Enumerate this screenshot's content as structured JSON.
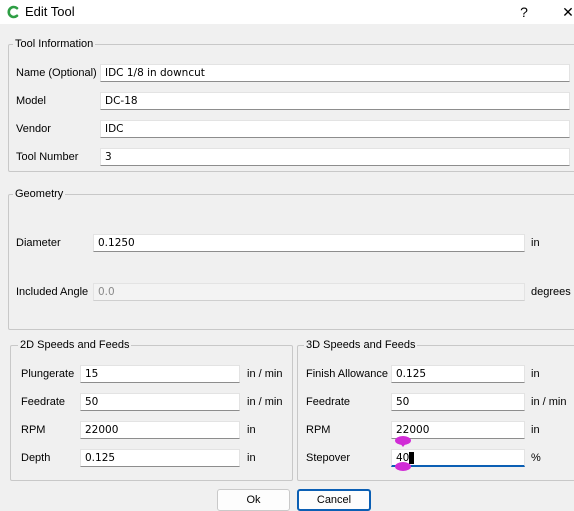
{
  "window": {
    "title": "Edit Tool",
    "help_label": "?",
    "close_label": "✕",
    "icon": "app-logo-icon"
  },
  "tool_info": {
    "legend": "Tool Information",
    "name_label": "Name (Optional)",
    "name_value": "IDC 1/8 in downcut",
    "model_label": "Model",
    "model_value": "DC-18",
    "vendor_label": "Vendor",
    "vendor_value": "IDC",
    "tool_number_label": "Tool Number",
    "tool_number_value": "3"
  },
  "geometry": {
    "legend": "Geometry",
    "diameter_label": "Diameter",
    "diameter_value": "0.1250",
    "diameter_unit": "in",
    "angle_label": "Included Angle",
    "angle_value": "0.0",
    "angle_unit": "degrees"
  },
  "speeds_2d": {
    "legend": "2D Speeds and Feeds",
    "plungerate_label": "Plungerate",
    "plungerate_value": "15",
    "plungerate_unit": "in / min",
    "feedrate_label": "Feedrate",
    "feedrate_value": "50",
    "feedrate_unit": "in / min",
    "rpm_label": "RPM",
    "rpm_value": "22000",
    "rpm_unit": "in",
    "depth_label": "Depth",
    "depth_value": "0.125",
    "depth_unit": "in"
  },
  "speeds_3d": {
    "legend": "3D Speeds and Feeds",
    "finish_label": "Finish Allowance",
    "finish_value": "0.125",
    "finish_unit": "in",
    "feedrate_label": "Feedrate",
    "feedrate_value": "50",
    "feedrate_unit": "in / min",
    "rpm_label": "RPM",
    "rpm_value": "22000",
    "rpm_unit": "in",
    "stepover_label": "Stepover",
    "stepover_value": "40",
    "stepover_unit": "%"
  },
  "buttons": {
    "ok_label": "Ok",
    "cancel_label": "Cancel"
  },
  "colors": {
    "accent": "#0b5fb4",
    "marker": "#d12cd6",
    "logo": "#2e9e44"
  }
}
